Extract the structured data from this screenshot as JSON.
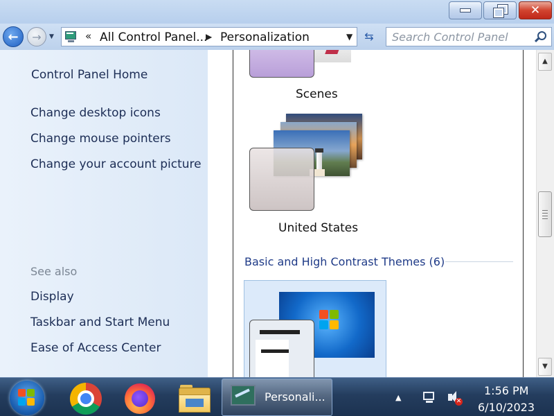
{
  "window": {
    "minimize_icon": "minimize-icon",
    "restore_icon": "restore-icon",
    "close_glyph": "✕"
  },
  "nav": {
    "back_glyph": "←",
    "forward_glyph": "→",
    "history_glyph": "▼"
  },
  "address": {
    "overflow_glyph": "«",
    "crumbs": [
      "All Control Panel...",
      "Personalization"
    ],
    "separator_glyph": "▶",
    "dropdown_glyph": "▼",
    "refresh_glyph": "⇆"
  },
  "search": {
    "placeholder": "Search Control Panel"
  },
  "sidebar": {
    "home": "Control Panel Home",
    "tasks": [
      "Change desktop icons",
      "Change mouse pointers",
      "Change your account picture"
    ],
    "see_also_title": "See also",
    "see_also": [
      "Display",
      "Taskbar and Start Menu",
      "Ease of Access Center"
    ]
  },
  "themes": {
    "items": [
      {
        "name": "Scenes"
      },
      {
        "name": "United States"
      }
    ],
    "basic_section": {
      "title": "Basic and High Contrast Themes (6)"
    }
  },
  "scrollbar": {
    "up_glyph": "▲",
    "down_glyph": "▼"
  },
  "taskbar": {
    "active_task_label": "Personali...",
    "tray_overflow_glyph": "▲",
    "time": "1:56 PM",
    "date": "6/10/2023",
    "apps": [
      "windows-start-icon",
      "chrome-icon",
      "firefox-icon",
      "file-explorer-icon"
    ]
  },
  "colors": {
    "link": "#1c2d55",
    "section_title": "#1e3a87",
    "taskbar": "#243d5e",
    "titlebar": "#c9dcf2"
  }
}
